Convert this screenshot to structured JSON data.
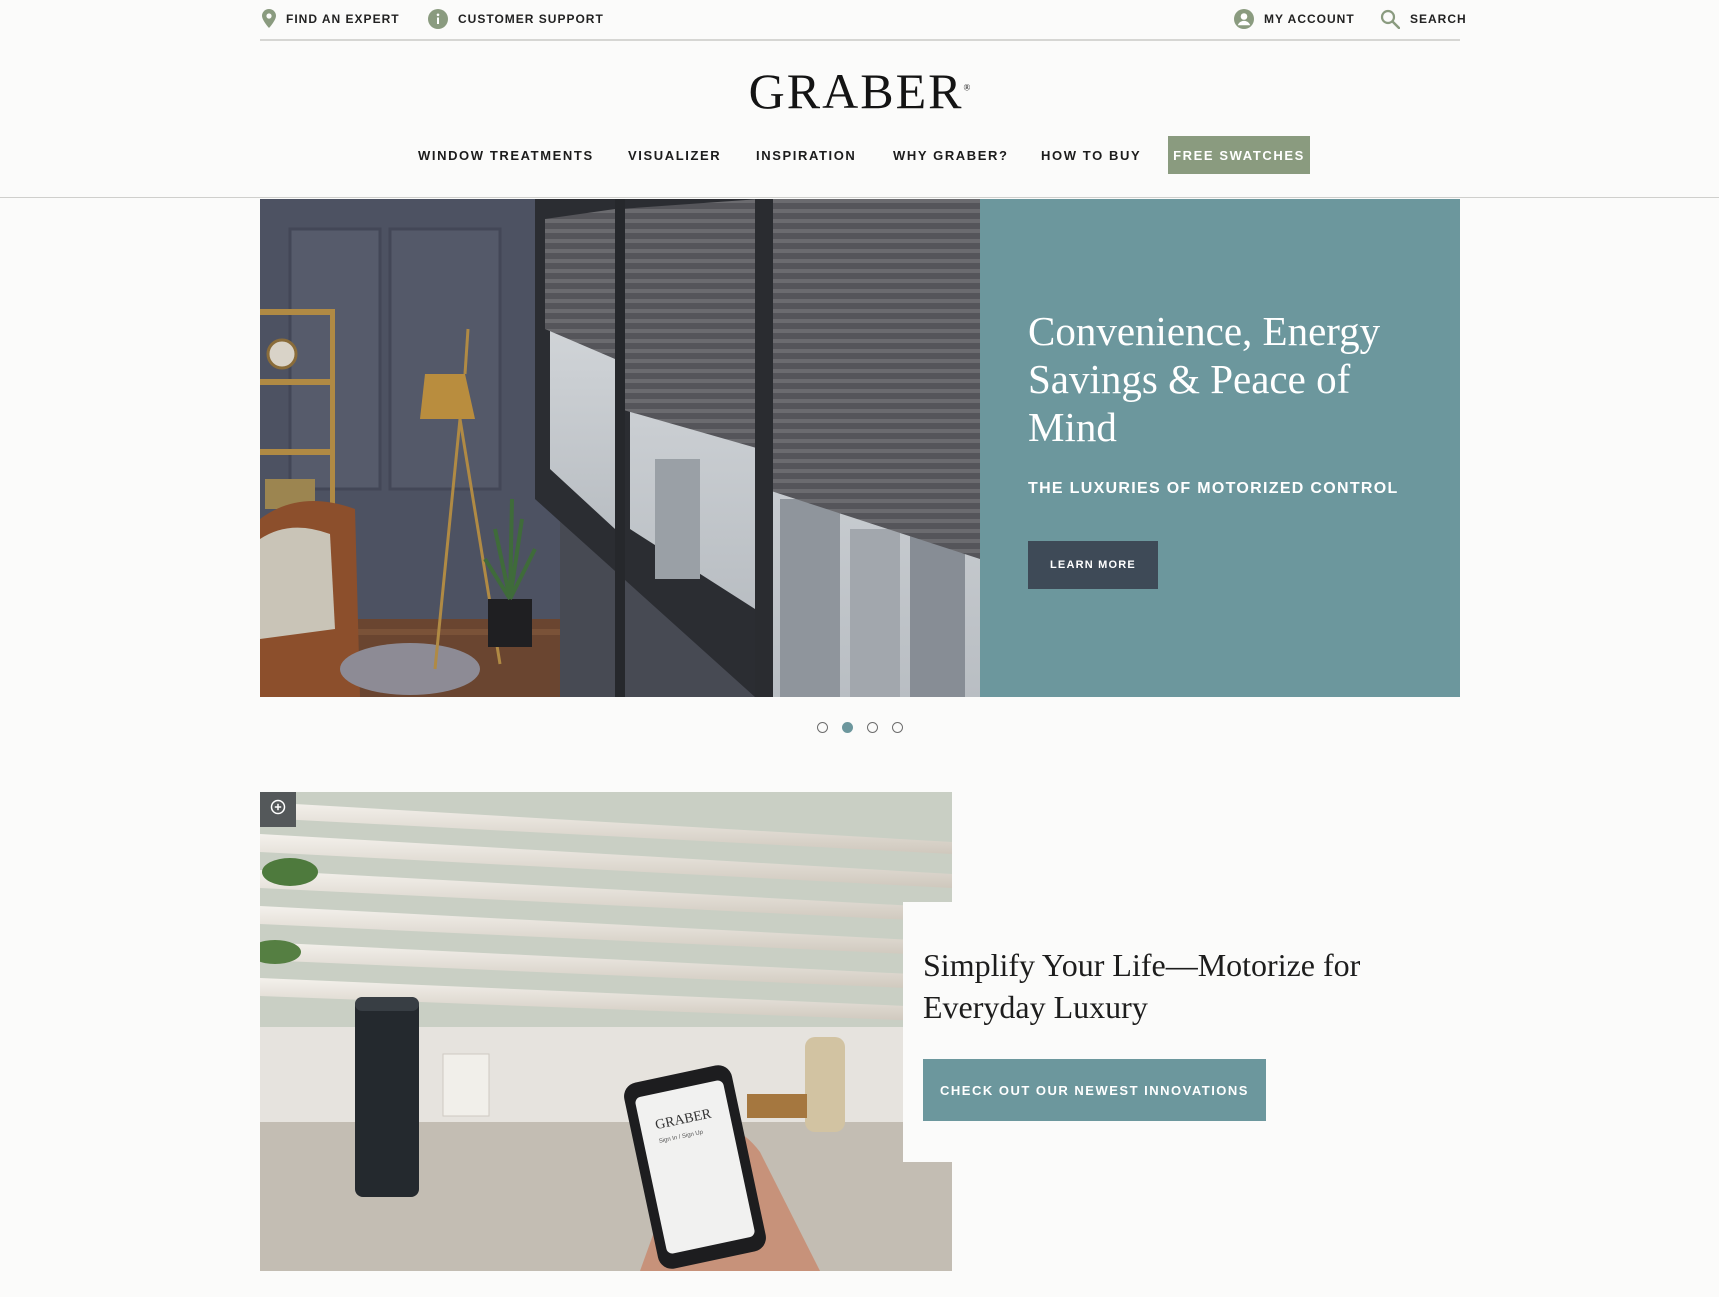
{
  "utility": {
    "find_expert": "FIND AN EXPERT",
    "customer_support": "CUSTOMER SUPPORT",
    "my_account": "MY ACCOUNT",
    "search": "SEARCH"
  },
  "brand": {
    "logo": "GRABER",
    "registered": "®"
  },
  "nav": {
    "items": [
      {
        "label": "WINDOW TREATMENTS"
      },
      {
        "label": "VISUALIZER"
      },
      {
        "label": "INSPIRATION"
      },
      {
        "label": "WHY GRABER?"
      },
      {
        "label": "HOW TO BUY"
      }
    ],
    "cta": "FREE SWATCHES"
  },
  "hero": {
    "title": "Convenience, Energy Savings & Peace of Mind",
    "subtitle": "THE LUXURIES OF MOTORIZED CONTROL",
    "button": "LEARN MORE",
    "slides": 4,
    "active_slide": 2
  },
  "feature": {
    "title": "Simplify Your Life—Motorize for Everyday Luxury",
    "button": "CHECK OUT OUR NEWEST INNOVATIONS"
  },
  "phone_screen": {
    "brand": "GRABER",
    "caption": "Sign In / Sign Up"
  },
  "colors": {
    "teal": "#6c979d",
    "sage": "#8a9b7f",
    "slate": "#3e4a57",
    "background": "#fbfbfa"
  }
}
